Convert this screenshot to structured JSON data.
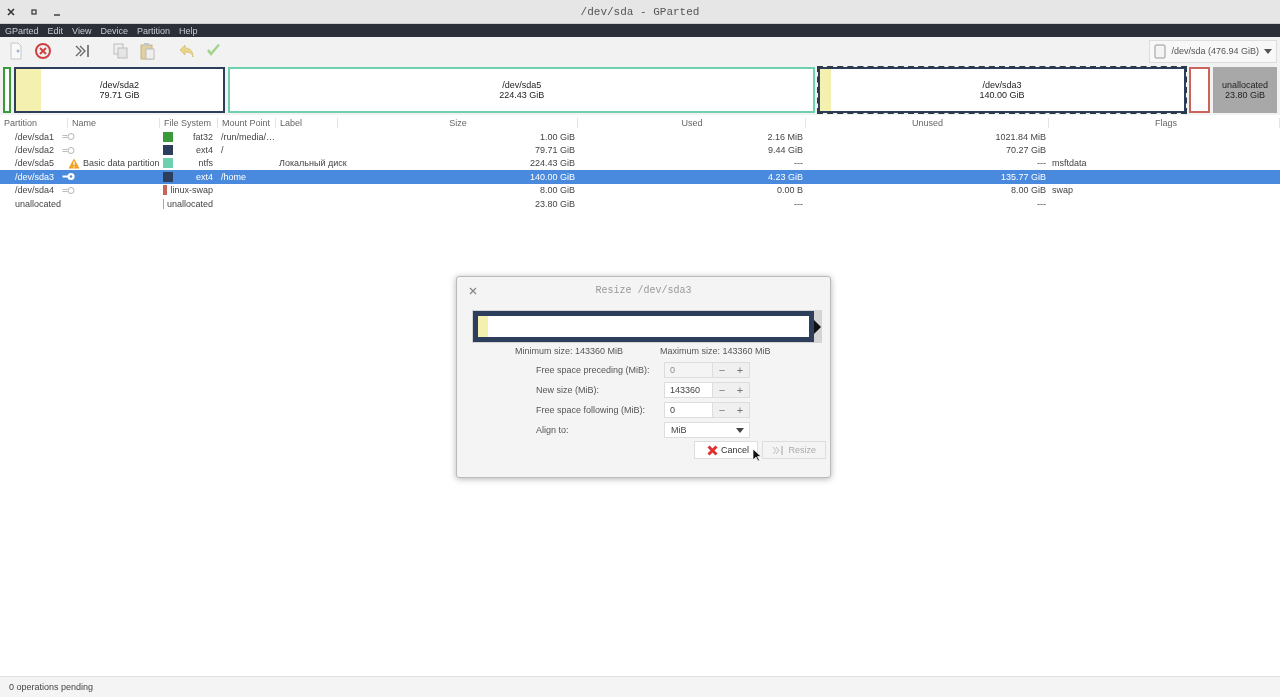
{
  "window": {
    "title": "/dev/sda - GParted"
  },
  "menu": [
    "GParted",
    "Edit",
    "View",
    "Device",
    "Partition",
    "Help"
  ],
  "toolbar": [
    {
      "kind": "new",
      "disabled": true
    },
    {
      "kind": "delete",
      "disabled": false
    },
    {
      "kind": "resize",
      "disabled": false
    },
    {
      "kind": "copy",
      "disabled": true
    },
    {
      "kind": "paste",
      "disabled": true
    },
    {
      "kind": "undo",
      "disabled": true
    },
    {
      "kind": "apply",
      "disabled": true
    }
  ],
  "device": {
    "label": "/dev/sda (476.94 GiB)"
  },
  "disk_map": [
    {
      "kind": "partition",
      "color": "#3a9a3a",
      "selected": false
    },
    {
      "kind": "partition",
      "color": "#2c3e5c",
      "level": 0.12,
      "selected": false,
      "name": "/dev/sda2",
      "size": "79.71 GiB"
    },
    {
      "kind": "partition",
      "color": "#6fd0b0",
      "selected": false,
      "name": "/dev/sda5",
      "size": "224.43 GiB"
    },
    {
      "kind": "partition",
      "color": "#2c3e5c",
      "level": 0.03,
      "selected": true,
      "name": "/dev/sda3",
      "size": "140.00 GiB"
    },
    {
      "kind": "partition",
      "color": "#c8645a",
      "selected": false
    },
    {
      "kind": "unallocated",
      "color": "#a8a8a8",
      "selected": false,
      "name": "unallocated",
      "size": "23.80 GiB"
    }
  ],
  "table": {
    "columns": [
      "Partition",
      "Name",
      "File System",
      "Mount Point",
      "Label",
      "Size",
      "Used",
      "Unused",
      "Flags"
    ],
    "rows": [
      {
        "kind": "partition",
        "partition": "/dev/sda1",
        "busy": false,
        "name": "",
        "color": "#3a9a3a",
        "file_system": "fat32",
        "mount_point": "/run/media/…",
        "label": "",
        "size": "1.00 GiB",
        "used": "2.16 MiB",
        "unused": "1021.84 MiB",
        "flags": "",
        "selected": false
      },
      {
        "kind": "partition",
        "partition": "/dev/sda2",
        "busy": false,
        "name": "",
        "color": "#2c3e5c",
        "file_system": "ext4",
        "mount_point": "/",
        "label": "",
        "size": "79.71 GiB",
        "used": "9.44 GiB",
        "unused": "70.27 GiB",
        "flags": "",
        "selected": false
      },
      {
        "kind": "partition",
        "partition": "/dev/sda5",
        "warning": true,
        "name": "Basic data partition",
        "color": "#6fd0b0",
        "file_system": "ntfs",
        "mount_point": "",
        "label": "Локальный диск",
        "size": "224.43 GiB",
        "used": "---",
        "unused": "---",
        "flags": "msftdata",
        "selected": false
      },
      {
        "kind": "partition",
        "partition": "/dev/sda3",
        "busy": true,
        "name": "",
        "color": "#2c3e5c",
        "file_system": "ext4",
        "mount_point": "/home",
        "label": "",
        "size": "140.00 GiB",
        "used": "4.23 GiB",
        "unused": "135.77 GiB",
        "flags": "",
        "selected": true
      },
      {
        "kind": "partition",
        "partition": "/dev/sda4",
        "busy": false,
        "name": "",
        "color": "#c8645a",
        "file_system": "linux-swap",
        "mount_point": "",
        "label": "",
        "size": "8.00 GiB",
        "used": "0.00 B",
        "unused": "8.00 GiB",
        "flags": "swap",
        "selected": false
      },
      {
        "kind": "unallocated",
        "partition": "unallocated",
        "name": "",
        "color": "#a8a8a8",
        "file_system": "unallocated",
        "mount_point": "",
        "label": "",
        "size": "23.80 GiB",
        "used": "---",
        "unused": "---",
        "flags": "",
        "selected": false
      }
    ]
  },
  "dialog": {
    "title": "Resize /dev/sda3",
    "partition_bar": {
      "level": 0.03
    },
    "min_size": "Minimum size: 143360 MiB",
    "max_size": "Maximum size: 143360 MiB",
    "fields": [
      {
        "kind": "spin",
        "label": "Free space preceding (MiB):",
        "value": "0",
        "disabled": true,
        "minus": "−",
        "plus": "+"
      },
      {
        "kind": "spin",
        "label": "New size (MiB):",
        "value": "143360",
        "disabled": false,
        "minus": "−",
        "plus": "+"
      },
      {
        "kind": "spin",
        "label": "Free space following (MiB):",
        "value": "0",
        "disabled": false,
        "minus": "−",
        "plus": "+"
      },
      {
        "kind": "select",
        "label": "Align to:",
        "value": "MiB"
      }
    ],
    "buttons": [
      {
        "kind": "cancel",
        "label": "Cancel",
        "disabled": false
      },
      {
        "kind": "resize",
        "label": "Resize",
        "disabled": true
      }
    ]
  },
  "status_bar": "0 operations pending"
}
